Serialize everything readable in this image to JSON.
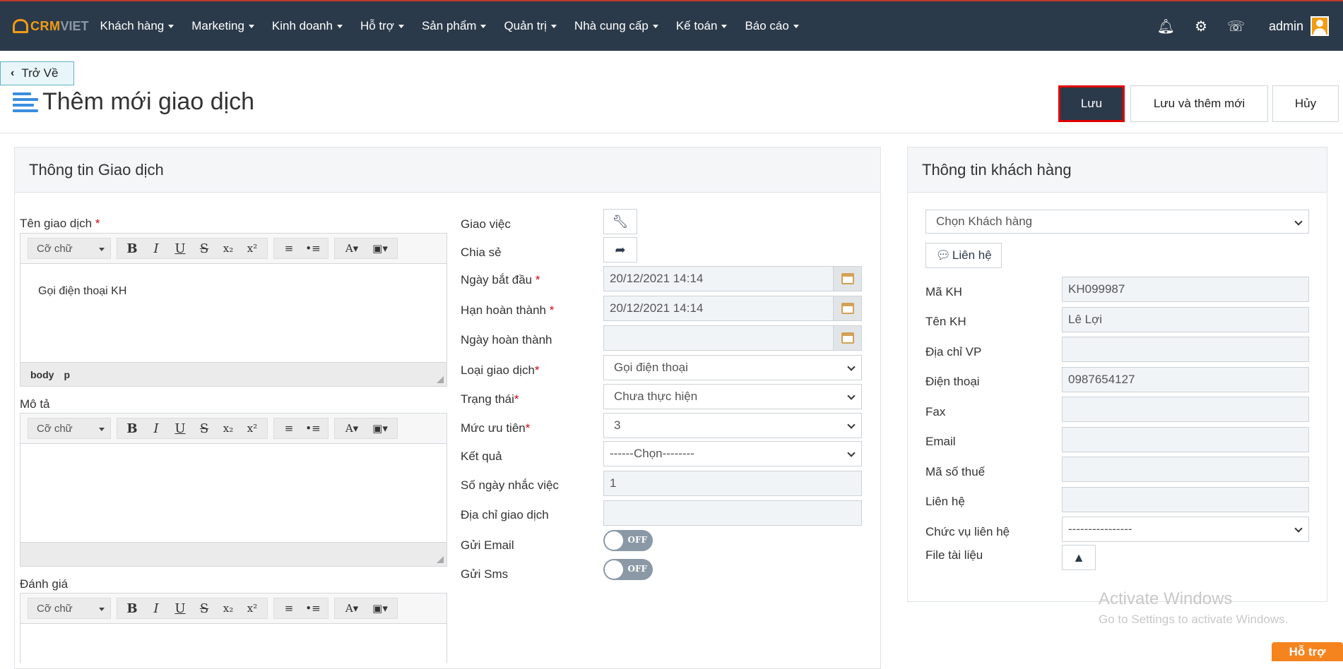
{
  "brand": {
    "logo_crm": "CRM",
    "logo_viet": "VIET"
  },
  "nav": {
    "menu": [
      "Khách hàng",
      "Marketing",
      "Kinh doanh",
      "Hỗ trợ",
      "Sản phẩm",
      "Quản trị",
      "Nhà cung cấp",
      "Kế toán",
      "Báo cáo"
    ],
    "user": "admin"
  },
  "header": {
    "back_label": "Trở Về",
    "title": "Thêm mới giao dịch",
    "save_label": "Lưu",
    "save_new_label": "Lưu và thêm mới",
    "cancel_label": "Hủy"
  },
  "left_panel": {
    "title": "Thông tin Giao dịch",
    "editors": {
      "name_label": "Tên giao dịch",
      "name_value": "Gọi điện thoại KH",
      "desc_label": "Mô tả",
      "rating_label": "Đánh giá",
      "font_select": "Cỡ chữ",
      "footer_body": "body",
      "footer_p": "p"
    },
    "fields": {
      "assign_label": "Giao việc",
      "share_label": "Chia sẻ",
      "start_label": "Ngày bắt đầu",
      "start_value": "20/12/2021 14:14",
      "deadline_label": "Hạn hoàn thành",
      "deadline_value": "20/12/2021 14:14",
      "done_label": "Ngày hoàn thành",
      "type_label": "Loại giao dịch",
      "type_value": "Gọi điện thoại",
      "status_label": "Trạng thái",
      "status_value": "Chưa thực hiện",
      "priority_label": "Mức ưu tiên",
      "priority_value": "3",
      "result_label": "Kết quả",
      "result_value": "------Chọn--------",
      "remind_label": "Số ngày nhắc việc",
      "remind_value": "1",
      "address_label": "Địa chỉ giao dịch",
      "email_label": "Gửi Email",
      "sms_label": "Gửi Sms",
      "toggle_off": "OFF"
    }
  },
  "right_panel": {
    "title": "Thông tin khách hàng",
    "customer_select": "Chọn Khách hàng",
    "contact_button": "Liên hệ",
    "fields": {
      "code_label": "Mã KH",
      "code_value": "KH099987",
      "name_label": "Tên KH",
      "name_value": "Lê Lợi",
      "addr_label": "Địa chỉ VP",
      "phone_label": "Điện thoại",
      "phone_value": "0987654127",
      "fax_label": "Fax",
      "email_label": "Email",
      "tax_label": "Mã số thuế",
      "contact_label": "Liên hệ",
      "position_label": "Chức vụ liên hệ",
      "position_value": "----------------",
      "file_label": "File tài liệu"
    }
  },
  "watermark": {
    "line1": "Activate Windows",
    "line2": "Go to Settings to activate Windows."
  },
  "support": "Hỗ trợ"
}
